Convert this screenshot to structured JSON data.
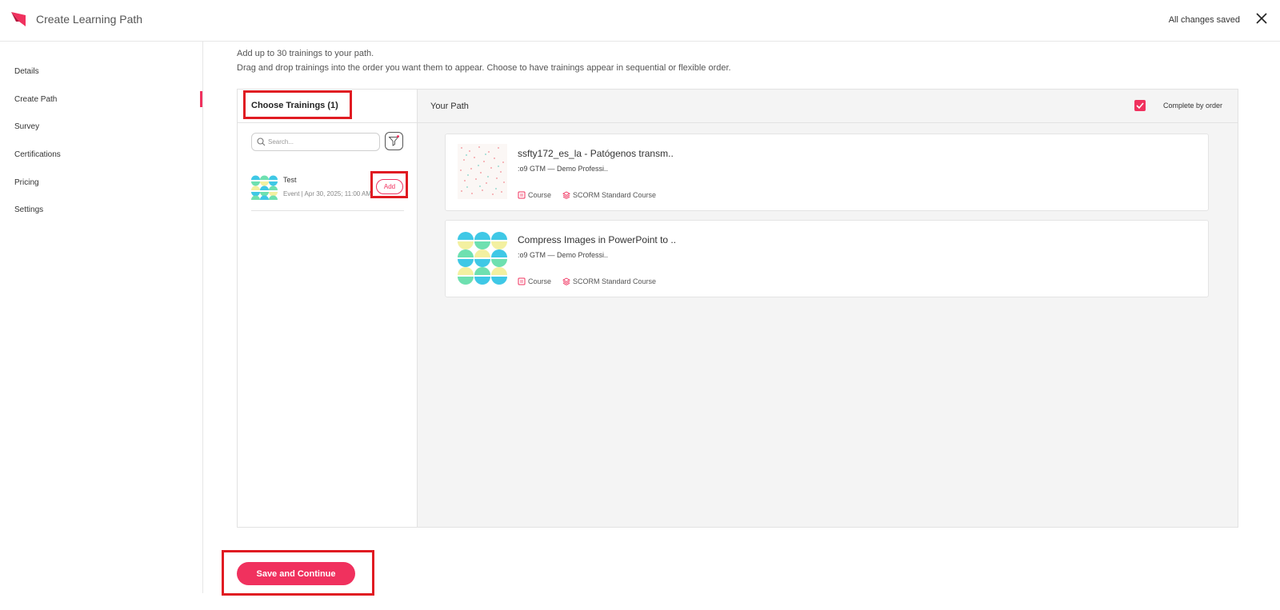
{
  "header": {
    "title": "Create Learning Path",
    "status": "All changes saved"
  },
  "sidebar": {
    "items": [
      {
        "label": "Details"
      },
      {
        "label": "Create Path"
      },
      {
        "label": "Survey"
      },
      {
        "label": "Certifications"
      },
      {
        "label": "Pricing"
      },
      {
        "label": "Settings"
      }
    ],
    "active": "Create Path"
  },
  "intro": {
    "line1": "Add up to 30 trainings to your path.",
    "line2": "Drag and drop trainings into the order you want them to appear. Choose to have trainings appear in sequential or flexible order."
  },
  "choose": {
    "title": "Choose Trainings (1)",
    "search_placeholder": "Search...",
    "items": [
      {
        "name": "Test",
        "meta": "Event | Apr 30, 2025; 11:00 AM",
        "add_label": "Add"
      }
    ]
  },
  "path": {
    "title": "Your Path",
    "complete_by_order_label": "Complete by order",
    "complete_by_order": true,
    "cards": [
      {
        "title": "ssfty172_es_la - Patógenos transm..",
        "subtitle": ":o9 GTM — Demo Professi..",
        "type": "Course",
        "format": "SCORM Standard Course"
      },
      {
        "title": "Compress Images in PowerPoint to ..",
        "subtitle": ":o9 GTM — Demo Professi..",
        "type": "Course",
        "format": "SCORM Standard Course"
      }
    ]
  },
  "footer": {
    "save_label": "Save and Continue"
  },
  "colors": {
    "accent": "#f0315e",
    "highlight": "#e01b22"
  }
}
